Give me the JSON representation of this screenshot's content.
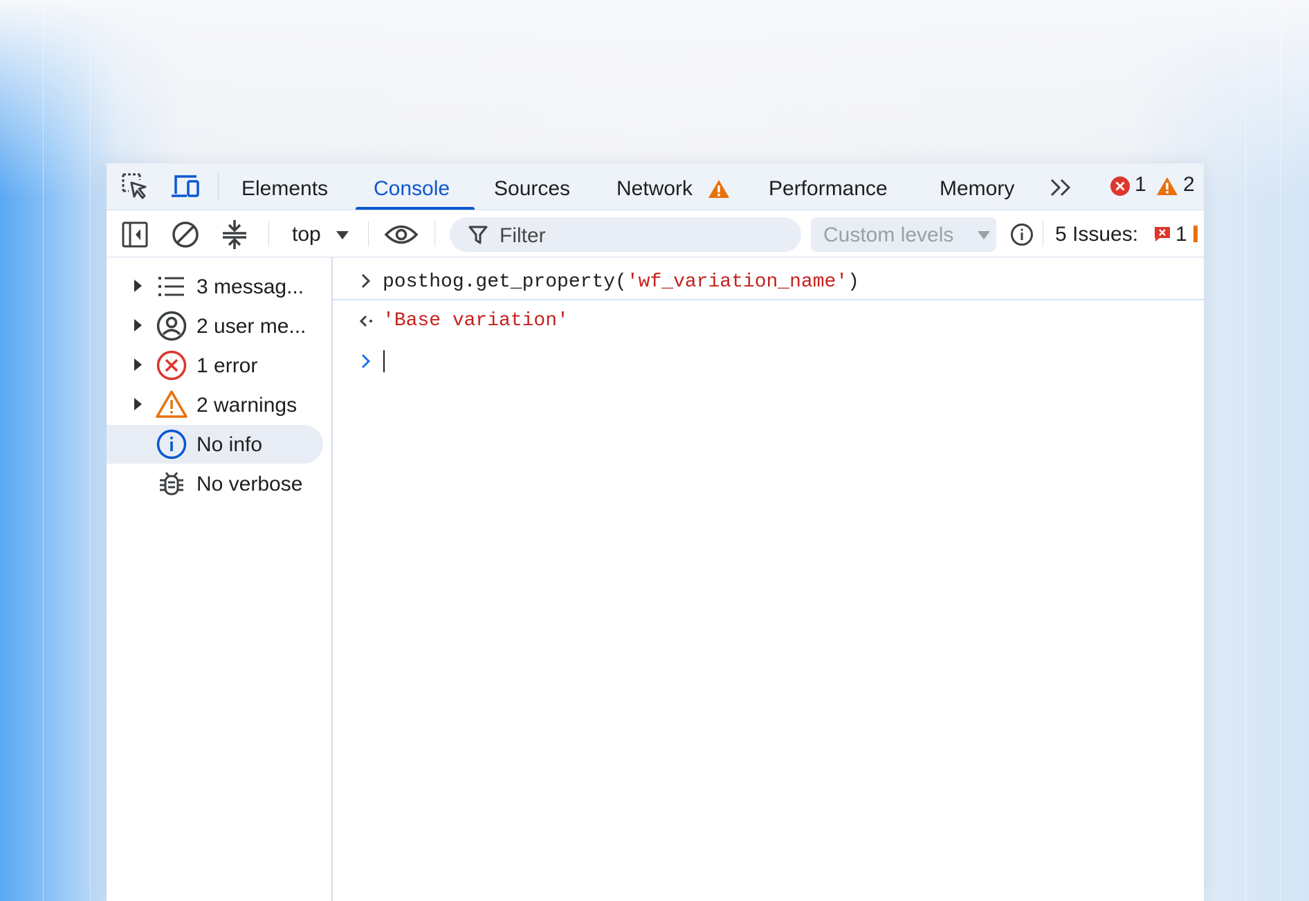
{
  "tabs": [
    {
      "label": "Elements",
      "active": false
    },
    {
      "label": "Console",
      "active": true
    },
    {
      "label": "Sources",
      "active": false
    },
    {
      "label": "Network",
      "active": false,
      "badge": "warning-icon"
    },
    {
      "label": "Performance",
      "active": false
    },
    {
      "label": "Memory",
      "active": false
    }
  ],
  "tab_counts": {
    "errors": "1",
    "warnings": "2"
  },
  "toolbar": {
    "context": "top",
    "filter_placeholder": "Filter",
    "levels_label": "Custom levels",
    "issues_label": "5 Issues:",
    "issues_error_count": "1"
  },
  "sidebar": {
    "items": [
      {
        "label": "3 messag...",
        "icon": "list-icon",
        "expandable": true
      },
      {
        "label": "2 user me...",
        "icon": "user-icon",
        "expandable": true
      },
      {
        "label": "1 error",
        "icon": "error-icon",
        "expandable": true
      },
      {
        "label": "2 warnings",
        "icon": "warning-icon",
        "expandable": true
      },
      {
        "label": "No info",
        "icon": "info-icon",
        "expandable": false,
        "selected": true
      },
      {
        "label": "No verbose",
        "icon": "bug-icon",
        "expandable": false
      }
    ]
  },
  "console": {
    "input_prefix": "posthog.get_property(",
    "input_arg": "'wf_variation_name'",
    "input_suffix": ")",
    "result": "'Base variation'"
  },
  "colors": {
    "accent": "#0b57d0",
    "error": "#dc362e",
    "warning": "#e8710a",
    "string": "#c5221f"
  }
}
